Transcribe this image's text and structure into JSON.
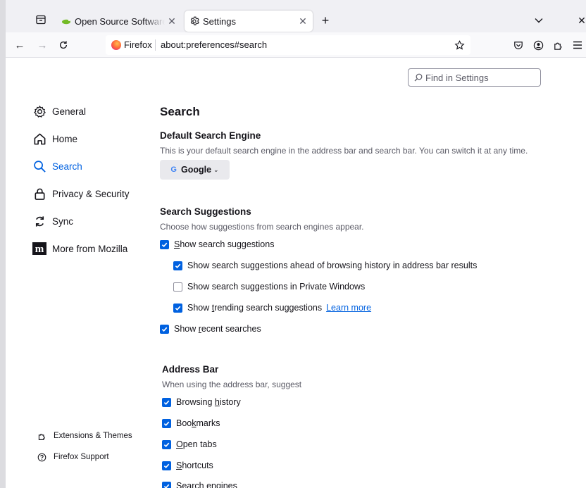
{
  "tabs": [
    {
      "title": "Open Source Software So",
      "active": false
    },
    {
      "title": "Settings",
      "active": true
    }
  ],
  "navbar": {
    "identity_label": "Firefox",
    "url": "about:preferences#search"
  },
  "find": {
    "placeholder": "Find in Settings"
  },
  "sidebar": {
    "items": [
      {
        "label": "General",
        "icon": "gear-icon",
        "selected": false
      },
      {
        "label": "Home",
        "icon": "home-icon",
        "selected": false
      },
      {
        "label": "Search",
        "icon": "search-icon",
        "selected": true
      },
      {
        "label": "Privacy & Security",
        "icon": "lock-icon",
        "selected": false
      },
      {
        "label": "Sync",
        "icon": "sync-icon",
        "selected": false
      },
      {
        "label": "More from Mozilla",
        "icon": "mozilla-icon",
        "selected": false
      }
    ],
    "footer": [
      {
        "label": "Extensions & Themes",
        "icon": "puzzle-icon"
      },
      {
        "label": "Firefox Support",
        "icon": "help-icon"
      }
    ]
  },
  "main": {
    "title": "Search",
    "default_engine": {
      "heading": "Default Search Engine",
      "description": "This is your default search engine in the address bar and search bar. You can switch it at any time.",
      "selected": "Google"
    },
    "suggestions": {
      "heading": "Search Suggestions",
      "description": "Choose how suggestions from search engines appear.",
      "show_suggestions": {
        "pre": "",
        "u": "S",
        "post": "how search suggestions",
        "checked": true
      },
      "ahead_of_history": {
        "pre": "Show search suggestions ahead of browsing history in address bar results",
        "u": "",
        "post": "",
        "checked": true
      },
      "private_windows": {
        "pre": "Show search suggestions in Private Windows",
        "u": "",
        "post": "",
        "checked": false
      },
      "trending": {
        "pre": "Show ",
        "u": "t",
        "post": "rending search suggestions",
        "checked": true,
        "learn_more": "Learn more"
      },
      "recent": {
        "pre": "Show ",
        "u": "r",
        "post": "ecent searches",
        "checked": true
      }
    },
    "address_bar": {
      "heading": "Address Bar",
      "description": "When using the address bar, suggest",
      "items": [
        {
          "pre": "Browsing ",
          "u": "h",
          "post": "istory",
          "checked": true
        },
        {
          "pre": "Boo",
          "u": "k",
          "post": "marks",
          "checked": true
        },
        {
          "pre": "",
          "u": "O",
          "post": "pen tabs",
          "checked": true
        },
        {
          "pre": "",
          "u": "S",
          "post": "hortcuts",
          "checked": true
        },
        {
          "pre": "Search engines",
          "u": "",
          "post": "",
          "checked": true
        }
      ]
    }
  },
  "colors": {
    "accent": "#0061e0",
    "tab_strip": "#f0f0f4",
    "text": "#15141a",
    "muted": "#5b5b66"
  }
}
